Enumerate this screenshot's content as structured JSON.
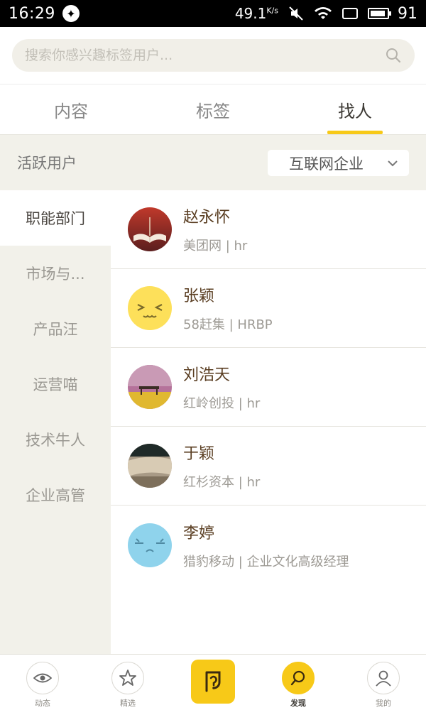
{
  "status_bar": {
    "time": "16:29",
    "net_speed": "49.1",
    "net_unit": "K/s",
    "battery": "91"
  },
  "search": {
    "placeholder": "搜索你感兴趣标签用户..."
  },
  "tabs": [
    {
      "label": "内容",
      "active": false
    },
    {
      "label": "标签",
      "active": false
    },
    {
      "label": "找人",
      "active": true
    }
  ],
  "filter": {
    "label": "活跃用户",
    "dropdown_value": "互联网企业"
  },
  "sidebar": {
    "items": [
      {
        "label": "职能部门",
        "active": true
      },
      {
        "label": "市场与...",
        "active": false
      },
      {
        "label": "产品汪",
        "active": false
      },
      {
        "label": "运营喵",
        "active": false
      },
      {
        "label": "技术牛人",
        "active": false
      },
      {
        "label": "企业高管",
        "active": false
      }
    ]
  },
  "users": [
    {
      "name": "赵永怀",
      "sub": "美团网 | hr",
      "avatar": "book-photo"
    },
    {
      "name": "张颖",
      "sub": "58赶集 | HRBP",
      "avatar": "yellow-emoji"
    },
    {
      "name": "刘浩天",
      "sub": "红岭创投 | hr",
      "avatar": "bench-photo"
    },
    {
      "name": "于颖",
      "sub": "红杉资本 | hr",
      "avatar": "landscape-photo"
    },
    {
      "name": "李婷",
      "sub": "猎豹移动 | 企业文化高级经理",
      "avatar": "blue-emoji"
    }
  ],
  "bottom_nav": [
    {
      "label": "动态",
      "icon": "eye-icon",
      "active": false
    },
    {
      "label": "精选",
      "icon": "star-icon",
      "active": false
    },
    {
      "label": "",
      "icon": "compose-icon",
      "active": false
    },
    {
      "label": "发现",
      "icon": "search-icon",
      "active": true
    },
    {
      "label": "我的",
      "icon": "user-icon",
      "active": false
    }
  ],
  "colors": {
    "accent": "#f7c918",
    "sidebar_bg": "#f2f1ea",
    "name_text": "#5a3e22"
  }
}
